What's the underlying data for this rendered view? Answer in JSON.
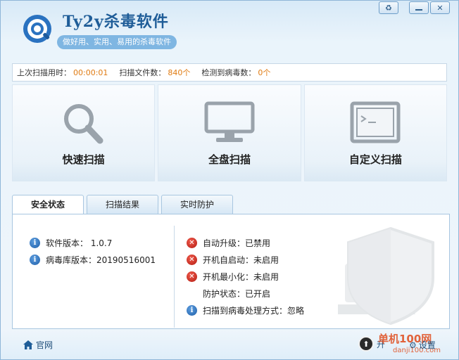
{
  "header": {
    "title": "Ty2y杀毒软件",
    "slogan": "做好用、实用、易用的杀毒软件",
    "logo_icon": "magnifier-logo-icon"
  },
  "window_controls": {
    "skin_icon": "recycle-icon",
    "min_icon": "minimize-icon",
    "close_icon": "close-icon"
  },
  "stats": {
    "last_scan_label": "上次扫描用时：",
    "last_scan_value": "00:00:01",
    "files_label": "扫描文件数：",
    "files_value": "840个",
    "virus_label": "检测到病毒数：",
    "virus_value": "0个"
  },
  "scan_tiles": [
    {
      "label": "快速扫描",
      "icon": "magnifier-icon"
    },
    {
      "label": "全盘扫描",
      "icon": "monitor-icon"
    },
    {
      "label": "自定义扫描",
      "icon": "terminal-icon"
    }
  ],
  "tabs": [
    {
      "label": "安全状态",
      "active": true
    },
    {
      "label": "扫描结果",
      "active": false
    },
    {
      "label": "实时防护",
      "active": false
    }
  ],
  "status_left": [
    {
      "text": "软件版本： 1.0.7",
      "icon": "info-icon"
    },
    {
      "text": "病毒库版本：20190516001",
      "icon": "info-icon"
    }
  ],
  "status_right": [
    {
      "text": "自动升级：已禁用",
      "icon": "error-icon"
    },
    {
      "text": "开机自启动：未启用",
      "icon": "error-icon"
    },
    {
      "text": "开机最小化：未启用",
      "icon": "error-icon"
    },
    {
      "text": "防护状态：已开启",
      "icon": "none"
    },
    {
      "text": "扫描到病毒处理方式：忽略",
      "icon": "info-icon"
    }
  ],
  "footer": {
    "home_label": "官网",
    "update_label": "升",
    "settings_label": "设置",
    "brand_text": "单机100网",
    "brand_url": "danji100.com"
  },
  "colors": {
    "accent": "#1f5d98",
    "value_orange": "#e07b12",
    "error_red": "#c8261a",
    "info_blue": "#2a6fbf"
  }
}
